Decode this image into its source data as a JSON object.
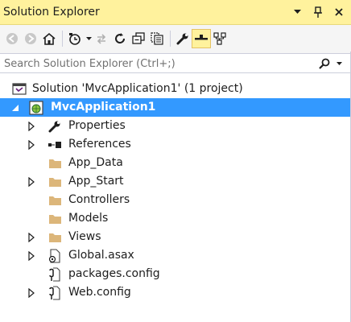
{
  "window": {
    "title": "Solution Explorer"
  },
  "search": {
    "placeholder": "Search Solution Explorer (Ctrl+;)"
  },
  "tree": {
    "solution": "Solution 'MvcApplication1' (1 project)",
    "project": "MvcApplication1",
    "items": [
      {
        "label": "Properties",
        "icon": "wrench-icon",
        "expandable": true
      },
      {
        "label": "References",
        "icon": "references-icon",
        "expandable": true
      },
      {
        "label": "App_Data",
        "icon": "folder-icon",
        "expandable": false
      },
      {
        "label": "App_Start",
        "icon": "folder-icon",
        "expandable": true
      },
      {
        "label": "Controllers",
        "icon": "folder-icon",
        "expandable": false
      },
      {
        "label": "Models",
        "icon": "folder-icon",
        "expandable": false
      },
      {
        "label": "Views",
        "icon": "folder-icon",
        "expandable": true
      },
      {
        "label": "Global.asax",
        "icon": "asax-file-icon",
        "expandable": true
      },
      {
        "label": "packages.config",
        "icon": "config-file-icon",
        "expandable": false
      },
      {
        "label": "Web.config",
        "icon": "config-file-icon",
        "expandable": true
      }
    ]
  },
  "colors": {
    "title_bar": "#fff29d",
    "selection": "#3399ff",
    "folder": "#dcb67a",
    "toolbar": "#f5f5f5"
  }
}
